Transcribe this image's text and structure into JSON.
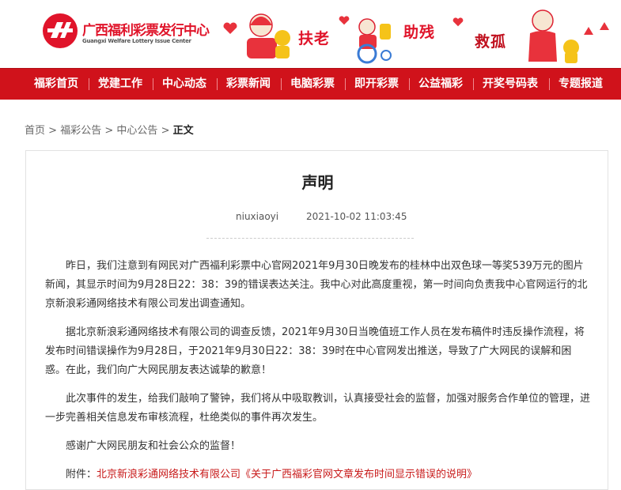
{
  "header": {
    "logo_cn": "广西福利彩票发行中心",
    "logo_en": "Guangxi Welfare Lottery Issue Center",
    "banner": [
      "扶老",
      "助残",
      "救孤"
    ]
  },
  "colors": {
    "brand_red": "#d0121b",
    "link_red": "#c81a1a"
  },
  "nav": [
    "福彩首页",
    "党建工作",
    "中心动态",
    "彩票新闻",
    "电脑彩票",
    "即开彩票",
    "公益福彩",
    "开奖号码表",
    "专题报道"
  ],
  "breadcrumb": {
    "home": "首页",
    "sep": ">",
    "level1": "福彩公告",
    "level2": "中心公告",
    "current": "正文"
  },
  "article": {
    "title": "声明",
    "author": "niuxiaoyi",
    "datetime": "2021-10-02 11:03:45",
    "paragraphs": [
      "昨日，我们注意到有网民对广西福利彩票中心官网2021年9月30日晚发布的桂林中出双色球一等奖539万元的图片新闻，其显示时间为9月28日22：38：39的错误表达关注。我中心对此高度重视，第一时间向负责我中心官网运行的北京新浪彩通网络技术有限公司发出调查通知。",
      "据北京新浪彩通网络技术有限公司的调查反馈，2021年9月30日当晚值班工作人员在发布稿件时违反操作流程，将发布时间错误操作为9月28日，于2021年9月30日22：38：39时在中心官网发出推送，导致了广大网民的误解和困惑。在此，我们向广大网民朋友表达诚挚的歉意！",
      "此次事件的发生，给我们敲响了警钟，我们将从中吸取教训，认真接受社会的监督，加强对服务合作单位的管理，进一步完善相关信息发布审核流程，杜绝类似的事件再次发生。",
      "感谢广大网民朋友和社会公众的监督！"
    ],
    "attachment_label": "附件：",
    "attachment_link": "北京新浪彩通网络技术有限公司《关于广西福彩官网文章发布时间显示错误的说明》"
  }
}
